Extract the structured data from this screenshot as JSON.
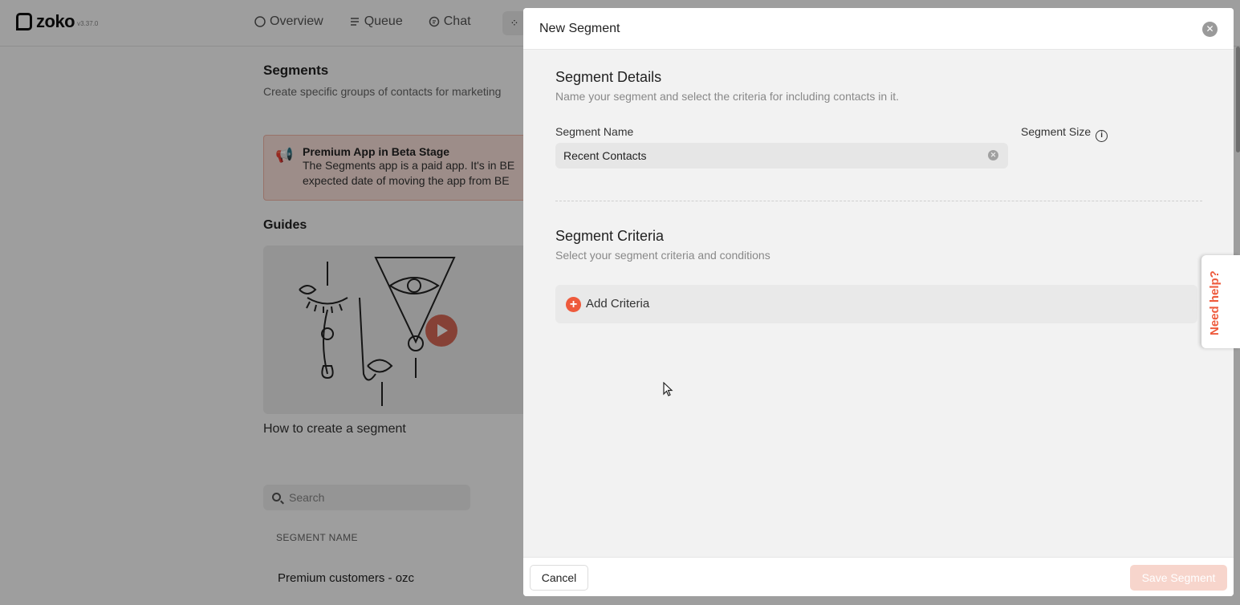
{
  "app": {
    "logo_text": "zoko",
    "version": "v3.37.0",
    "nav": [
      {
        "label": "Overview",
        "icon": "circle-icon"
      },
      {
        "label": "Queue",
        "icon": "list-icon"
      },
      {
        "label": "Chat",
        "icon": "chat-icon"
      }
    ],
    "apps_icon": "grid-icon"
  },
  "page": {
    "title": "Segments",
    "subtitle": "Create specific groups of contacts for marketing",
    "beta": {
      "icon": "megaphone-icon",
      "title": "Premium App in Beta Stage",
      "line1": "The Segments app is a paid app. It's in BE",
      "line2": "expected date of moving the app from BE"
    },
    "guides_title": "Guides",
    "video_caption": "How to create a segment",
    "search_placeholder": "Search",
    "column_header": "SEGMENT NAME",
    "rows": [
      "Premium customers - ozc"
    ]
  },
  "modal": {
    "title": "New Segment",
    "details": {
      "title": "Segment Details",
      "subtitle": "Name your segment and select the criteria for including contacts in it.",
      "name_label": "Segment Name",
      "name_value": "Recent Contacts",
      "size_label": "Segment Size"
    },
    "criteria": {
      "title": "Segment Criteria",
      "subtitle": "Select your segment criteria and conditions",
      "add_label": "Add Criteria"
    },
    "footer": {
      "cancel": "Cancel",
      "save": "Save Segment"
    }
  },
  "help_tab": "Need help?",
  "colors": {
    "accent": "#ee5a3c",
    "beta_bg": "#fde4dd",
    "save_disabled": "#f7d5cc"
  }
}
